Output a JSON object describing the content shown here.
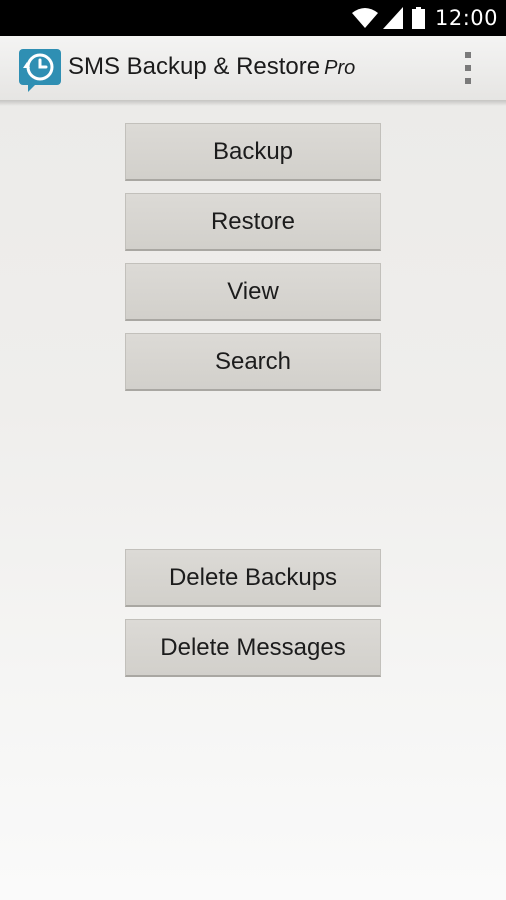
{
  "status_bar": {
    "time": "12:00",
    "icons": [
      "wifi-icon",
      "signal-icon",
      "battery-icon"
    ]
  },
  "action_bar": {
    "app_icon": "sms-backup-clock-icon",
    "title": "SMS Backup & Restore",
    "title_suffix": "Pro",
    "overflow_icon": "overflow-menu-icon"
  },
  "main": {
    "buttons": {
      "backup": "Backup",
      "restore": "Restore",
      "view": "View",
      "search": "Search",
      "delete_backups": "Delete Backups",
      "delete_messages": "Delete Messages"
    }
  },
  "colors": {
    "status_bar_bg": "#000000",
    "action_bar_bg": "#ececea",
    "button_bg": "#d6d4d0",
    "app_icon_blue": "#2f8fb3"
  }
}
